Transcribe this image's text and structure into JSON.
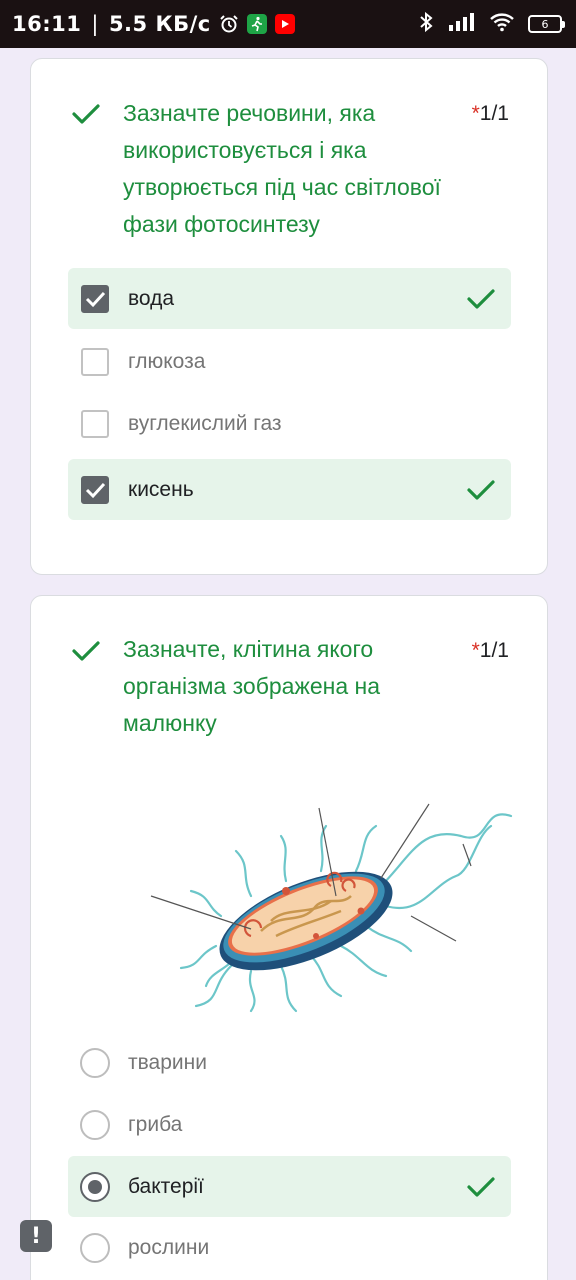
{
  "status_bar": {
    "time": "16:11",
    "separator": "|",
    "speed": "5.5 КБ/с",
    "battery": "6",
    "icons": [
      "alarm-icon",
      "walk-icon",
      "youtube-icon",
      "bluetooth-icon",
      "signal-icon",
      "wifi-icon",
      "battery-icon"
    ]
  },
  "questions": [
    {
      "title": "Зазначте речовини, яка використовується і яка утворюється під час світлової фази фотосинтезу",
      "required_mark": "*",
      "score": "1/1",
      "type": "checkbox",
      "options": [
        {
          "label": "вода",
          "checked": true,
          "correct": true
        },
        {
          "label": "глюкоза",
          "checked": false,
          "correct": false
        },
        {
          "label": "вуглекислий газ",
          "checked": false,
          "correct": false
        },
        {
          "label": "кисень",
          "checked": true,
          "correct": true
        }
      ]
    },
    {
      "title": "Зазначте, клітина якого організма зображена на малюнку",
      "required_mark": "*",
      "score": "1/1",
      "type": "radio",
      "options": [
        {
          "label": "тварини",
          "checked": false,
          "correct": false
        },
        {
          "label": "гриба",
          "checked": false,
          "correct": false
        },
        {
          "label": "бактерії",
          "checked": true,
          "correct": true
        },
        {
          "label": "рослини",
          "checked": false,
          "correct": false
        }
      ]
    }
  ],
  "colors": {
    "correct_green": "#1e8e3e",
    "correct_bg": "#e6f4ea",
    "required_red": "#d93025",
    "page_bg": "#f0ebf8"
  },
  "report_button_icon": "report-icon"
}
